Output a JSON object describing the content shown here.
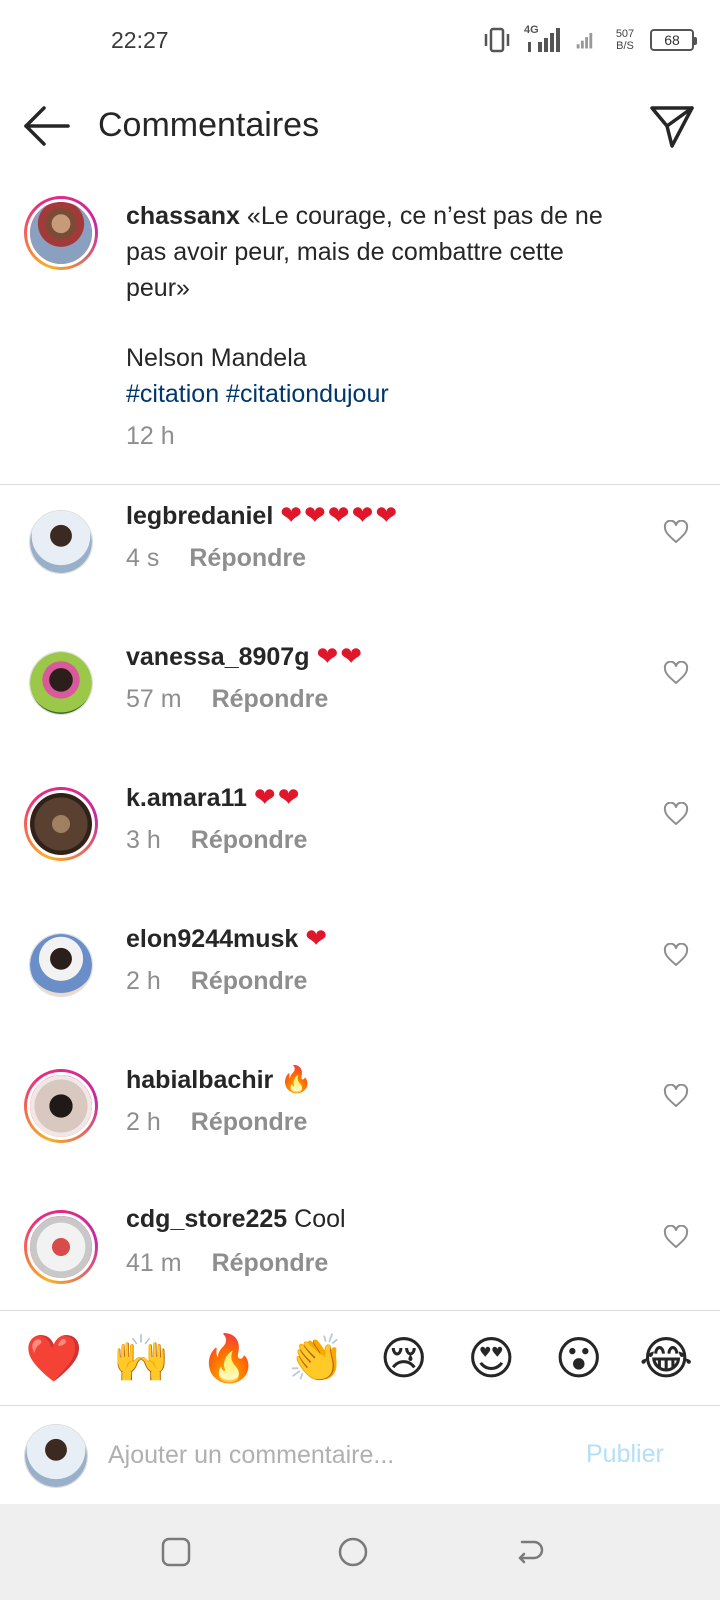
{
  "status_bar": {
    "time": "22:27",
    "network": "4G",
    "speed_value": "507",
    "speed_unit": "B/S",
    "battery": "68"
  },
  "header": {
    "title": "Commentaires",
    "back_icon": "arrow-left-icon",
    "send_icon": "paper-plane-icon"
  },
  "caption": {
    "username": "chassanx",
    "text": "«Le courage, ce n’est pas de ne pas avoir peur, mais de combattre cette peur»",
    "author": "Nelson Mandela",
    "hashtags": "#citation #citationdujour",
    "time": "12 h"
  },
  "reply_label": "Répondre",
  "comments": [
    {
      "username": "legbredaniel",
      "text": "❤❤❤❤❤",
      "time": "4 s"
    },
    {
      "username": "vanessa_8907g",
      "text": "❤❤",
      "time": "57 m"
    },
    {
      "username": "k.amara11",
      "text": "❤❤",
      "time": "3 h"
    },
    {
      "username": "elon9244musk",
      "text": "❤",
      "time": "2 h"
    },
    {
      "username": "habialbachir",
      "text": "🔥",
      "time": "2 h"
    },
    {
      "username": "cdg_store225",
      "text": "Cool",
      "time": "41 m"
    }
  ],
  "emoji_bar": [
    "❤️",
    "🙌",
    "🔥",
    "👏",
    "😢",
    "😍",
    "😮",
    "😂"
  ],
  "input": {
    "placeholder": "Ajouter un commentaire...",
    "value": "",
    "publish_label": "Publier"
  },
  "colors": {
    "hashtag": "#00376b",
    "secondary_text": "#8e8e8e",
    "publish_disabled": "#b2dffc",
    "heart": "#e0162b"
  }
}
